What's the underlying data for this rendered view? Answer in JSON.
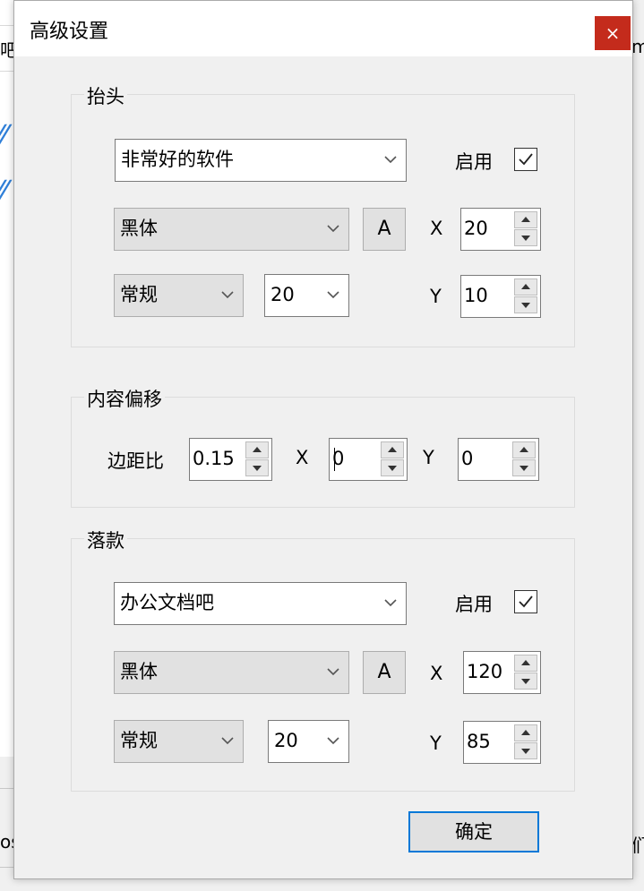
{
  "dialog": {
    "title": "高级设置",
    "close_label": "×",
    "ok_label": "确定"
  },
  "background": {
    "left_top_fragment": "吧",
    "right_top_fragment": "m",
    "left_bottom_fragment": "os",
    "right_bottom_fragment": "们",
    "accent": "#2f7fd8"
  },
  "header_group": {
    "legend": "抬头",
    "text_value": "非常好的软件",
    "enable_label": "启用",
    "enabled": true,
    "font_name": "黑体",
    "font_button_label": "A",
    "x_label": "X",
    "x_value": "20",
    "font_style": "常规",
    "font_size": "20",
    "y_label": "Y",
    "y_value": "10"
  },
  "offset_group": {
    "legend": "内容偏移",
    "margin_label": "边距比",
    "margin_value": "0.15",
    "x_label": "X",
    "x_value": "0",
    "y_label": "Y",
    "y_value": "0"
  },
  "footer_group": {
    "legend": "落款",
    "text_value": "办公文档吧",
    "enable_label": "启用",
    "enabled": true,
    "font_name": "黑体",
    "font_button_label": "A",
    "x_label": "X",
    "x_value": "120",
    "font_style": "常规",
    "font_size": "20",
    "y_label": "Y",
    "y_value": "85"
  }
}
